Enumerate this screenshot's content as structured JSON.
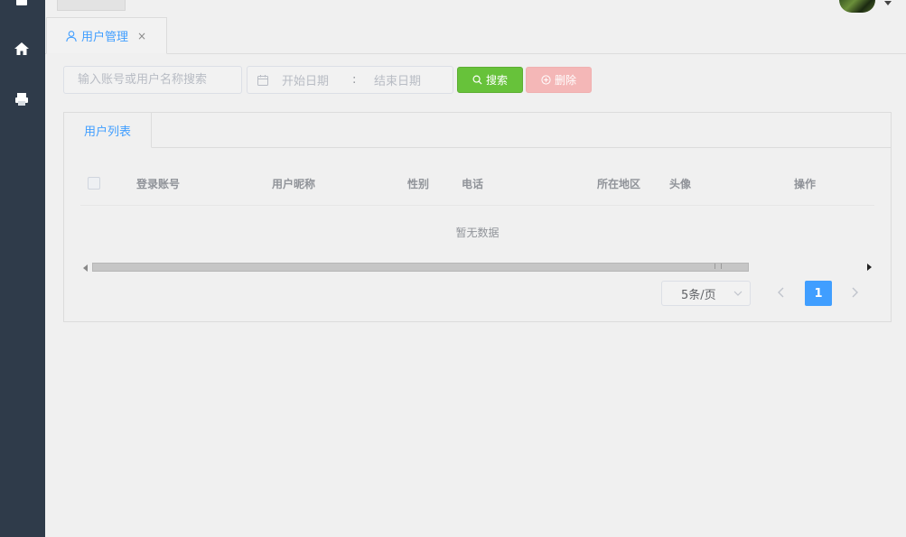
{
  "header": {
    "page_tab_label": "用户管理",
    "page_tab_close": "×"
  },
  "filters": {
    "search_placeholder": "输入账号或用户名称搜索",
    "start_date_placeholder": "开始日期",
    "range_separator": ":",
    "end_date_placeholder": "结束日期",
    "search_button": "搜索",
    "delete_button": "删除"
  },
  "card": {
    "tab_label": "用户列表",
    "columns": [
      "登录账号",
      "用户昵称",
      "性别",
      "电话",
      "所在地区",
      "头像",
      "操作"
    ],
    "empty_text": "暂无数据"
  },
  "pagination": {
    "page_size": "5条/页",
    "current_page": "1"
  },
  "colors": {
    "sidebar": "#2f3b4a",
    "primary": "#409eff",
    "search_button": "#67c23a",
    "delete_button": "#f4b7b7"
  }
}
